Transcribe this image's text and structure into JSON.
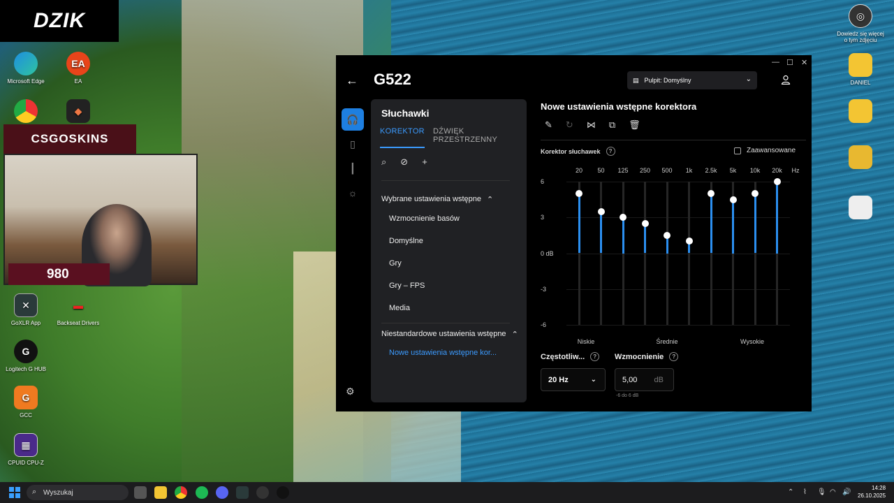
{
  "desktop": {
    "brand_logo": "DZIK",
    "overlay_banner": "CSGOSKINS",
    "webcam_score": "980",
    "icons_left": [
      {
        "label": "Microsoft Edge"
      },
      {
        "label": "EA"
      },
      {
        "label": "GoXLR App"
      },
      {
        "label": "Backseat Drivers"
      },
      {
        "label": "Logitech G HUB"
      },
      {
        "label": "GCC"
      },
      {
        "label": "CPUID CPU-Z"
      }
    ],
    "icons_right": [
      {
        "label": "Dowiedz się więcej o tym zdjęciu"
      },
      {
        "label": "DANIEL"
      }
    ]
  },
  "app": {
    "device_title": "G522",
    "profile_selector": "Pulpit: Domyślny",
    "panel": {
      "title": "Słuchawki",
      "tabs": [
        "KOREKTOR",
        "DŹWIĘK PRZESTRZENNY"
      ],
      "active_tab": "KOREKTOR",
      "group_builtin": "Wybrane ustawienia wstępne",
      "presets": [
        "Wzmocnienie basów",
        "Domyślne",
        "Gry",
        "Gry – FPS",
        "Media"
      ],
      "group_custom": "Niestandardowe ustawienia wstępne",
      "custom_presets": [
        "Nowe ustawienia wstępne kor..."
      ]
    },
    "eq": {
      "title": "Nowe ustawienia wstępne korektora",
      "subtitle": "Korektor słuchawek",
      "advanced_label": "Zaawansowane",
      "advanced_checked": false,
      "freq_unit": "Hz",
      "bands": [
        {
          "freq": "20",
          "gain": 5
        },
        {
          "freq": "50",
          "gain": 3.5
        },
        {
          "freq": "125",
          "gain": 3
        },
        {
          "freq": "250",
          "gain": 2.5
        },
        {
          "freq": "500",
          "gain": 1.5
        },
        {
          "freq": "1k",
          "gain": 1
        },
        {
          "freq": "2.5k",
          "gain": 5
        },
        {
          "freq": "5k",
          "gain": 4.5
        },
        {
          "freq": "10k",
          "gain": 5
        },
        {
          "freq": "20k",
          "gain": 6
        }
      ],
      "db_labels": [
        "6",
        "3",
        "0 dB",
        "-3",
        "-6"
      ],
      "band_groups": [
        "Niskie",
        "Średnie",
        "Wysokie"
      ],
      "frequency_label": "Częstotliw...",
      "gain_label": "Wzmocnienie",
      "frequency_value": "20 Hz",
      "gain_value": "5,00",
      "gain_unit": "dB",
      "gain_range": "-6 do 6 dB",
      "accent_color": "#2b8ff0"
    }
  },
  "taskbar": {
    "search_placeholder": "Wyszukaj",
    "time": "14:28",
    "date": "26.10.2025"
  }
}
